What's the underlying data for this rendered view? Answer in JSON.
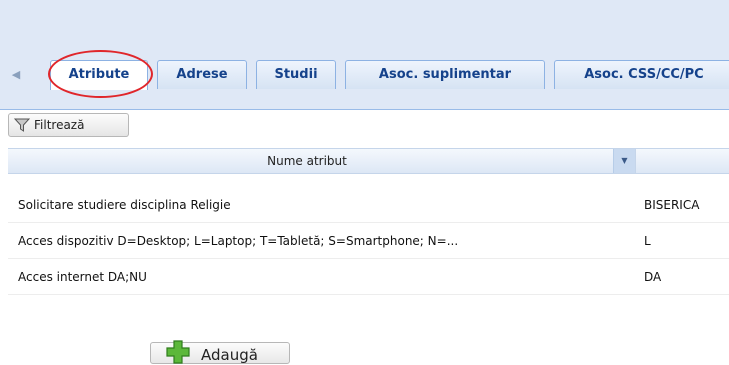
{
  "tabs": [
    {
      "label": "Atribute",
      "active": true
    },
    {
      "label": "Adrese"
    },
    {
      "label": "Studii"
    },
    {
      "label": "Asoc. suplimentar"
    },
    {
      "label": "Asoc. CSS/CC/PC"
    }
  ],
  "toolbar": {
    "filter_label": "Filtrează"
  },
  "grid": {
    "column_header": "Nume atribut",
    "rows": [
      {
        "name": "Solicitare studiere disciplina Religie",
        "value": "BISERICA "
      },
      {
        "name": "Acces dispozitiv D=Desktop; L=Laptop; T=Tabletă; S=Smartphone; N=...",
        "value": "L"
      },
      {
        "name": "Acces internet DA;NU",
        "value": "DA"
      }
    ]
  },
  "add_button": {
    "label": "Adaugă"
  },
  "colors": {
    "highlight": "#e0262b",
    "tab_text": "#15428b",
    "panel": "#dfe8f6"
  }
}
